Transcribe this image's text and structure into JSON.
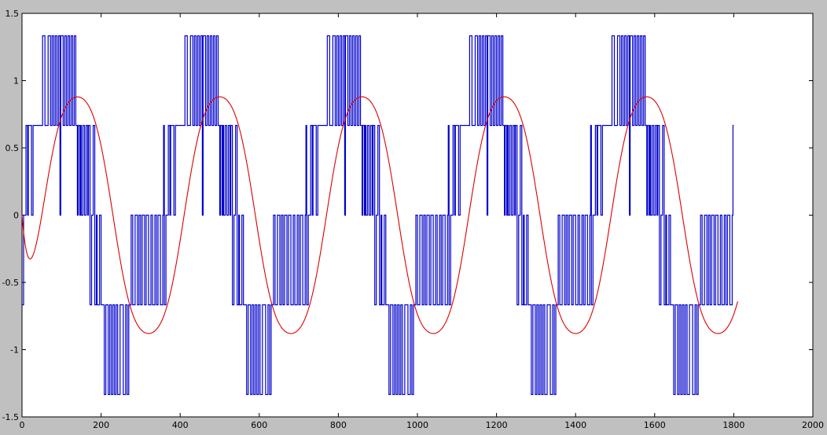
{
  "chart_data": {
    "type": "line",
    "title": "",
    "xlabel": "",
    "ylabel": "",
    "xlim": [
      0,
      2000
    ],
    "ylim": [
      -1.5,
      1.5
    ],
    "grid": false,
    "legend": "none",
    "x_ticks": [
      "0",
      "200",
      "400",
      "600",
      "800",
      "1000",
      "1200",
      "1400",
      "1600",
      "1800",
      "2000"
    ],
    "y_ticks": [
      "1.5",
      "1",
      "0.5",
      "0",
      "-0.5",
      "-1",
      "-1.5"
    ],
    "colors": {
      "background": "#c0c0c0",
      "axes": "#ffffff",
      "pwm": "#0000cc",
      "sine": "#dd0000"
    },
    "series": [
      {
        "kind": "step",
        "x_max": 1800,
        "period": 360,
        "pwm_steps_one_period": [
          [
            0,
            -0.6667
          ],
          [
            4,
            0
          ],
          [
            10,
            0.6667
          ],
          [
            14,
            0
          ],
          [
            16,
            0.6667
          ],
          [
            24,
            0
          ],
          [
            28,
            0.6667
          ],
          [
            52,
            1.3333
          ],
          [
            58,
            0.6667
          ],
          [
            66,
            1.3333
          ],
          [
            72,
            0.6667
          ],
          [
            76,
            1.3333
          ],
          [
            80,
            0.6667
          ],
          [
            84,
            1.3333
          ],
          [
            88,
            0.6667
          ],
          [
            92,
            1.3333
          ],
          [
            96,
            0
          ],
          [
            98,
            1.3333
          ],
          [
            104,
            0.6667
          ],
          [
            108,
            1.3333
          ],
          [
            112,
            0.6667
          ],
          [
            116,
            1.3333
          ],
          [
            120,
            0.6667
          ],
          [
            124,
            1.3333
          ],
          [
            128,
            0.6667
          ],
          [
            132,
            1.3333
          ],
          [
            136,
            0.6667
          ],
          [
            140,
            0
          ],
          [
            142,
            0.6667
          ],
          [
            146,
            0
          ],
          [
            148,
            0.6667
          ],
          [
            150,
            0
          ],
          [
            154,
            0.6667
          ],
          [
            158,
            0
          ],
          [
            162,
            0.6667
          ],
          [
            166,
            0
          ],
          [
            168,
            0.6667
          ],
          [
            172,
            -0.6667
          ],
          [
            176,
            0
          ],
          [
            180,
            0.6667
          ],
          [
            184,
            -0.6667
          ],
          [
            188,
            0
          ],
          [
            190,
            -0.6667
          ],
          [
            196,
            0
          ],
          [
            200,
            -0.6667
          ],
          [
            208,
            -1.3333
          ],
          [
            212,
            -0.6667
          ],
          [
            218,
            -1.3333
          ],
          [
            222,
            -0.6667
          ],
          [
            226,
            -1.3333
          ],
          [
            230,
            -0.6667
          ],
          [
            234,
            -1.3333
          ],
          [
            238,
            -0.6667
          ],
          [
            242,
            -1.3333
          ],
          [
            248,
            -0.6667
          ],
          [
            256,
            -1.3333
          ],
          [
            262,
            -0.6667
          ],
          [
            266,
            -1.3333
          ],
          [
            270,
            -0.6667
          ],
          [
            276,
            0
          ],
          [
            280,
            -0.6667
          ],
          [
            286,
            0
          ],
          [
            292,
            -0.6667
          ],
          [
            296,
            0
          ],
          [
            300,
            -0.6667
          ],
          [
            304,
            0
          ],
          [
            310,
            -0.6667
          ],
          [
            314,
            0
          ],
          [
            320,
            -0.6667
          ],
          [
            326,
            0
          ],
          [
            330,
            -0.6667
          ],
          [
            336,
            0
          ],
          [
            340,
            -0.6667
          ],
          [
            344,
            0
          ],
          [
            350,
            -0.6667
          ],
          [
            356,
            0
          ],
          [
            358,
            0.6667
          ]
        ]
      },
      {
        "kind": "smooth",
        "x_range": [
          0,
          1810
        ],
        "amplitude": 0.93,
        "period": 360,
        "phase_shift": 50
      }
    ]
  }
}
